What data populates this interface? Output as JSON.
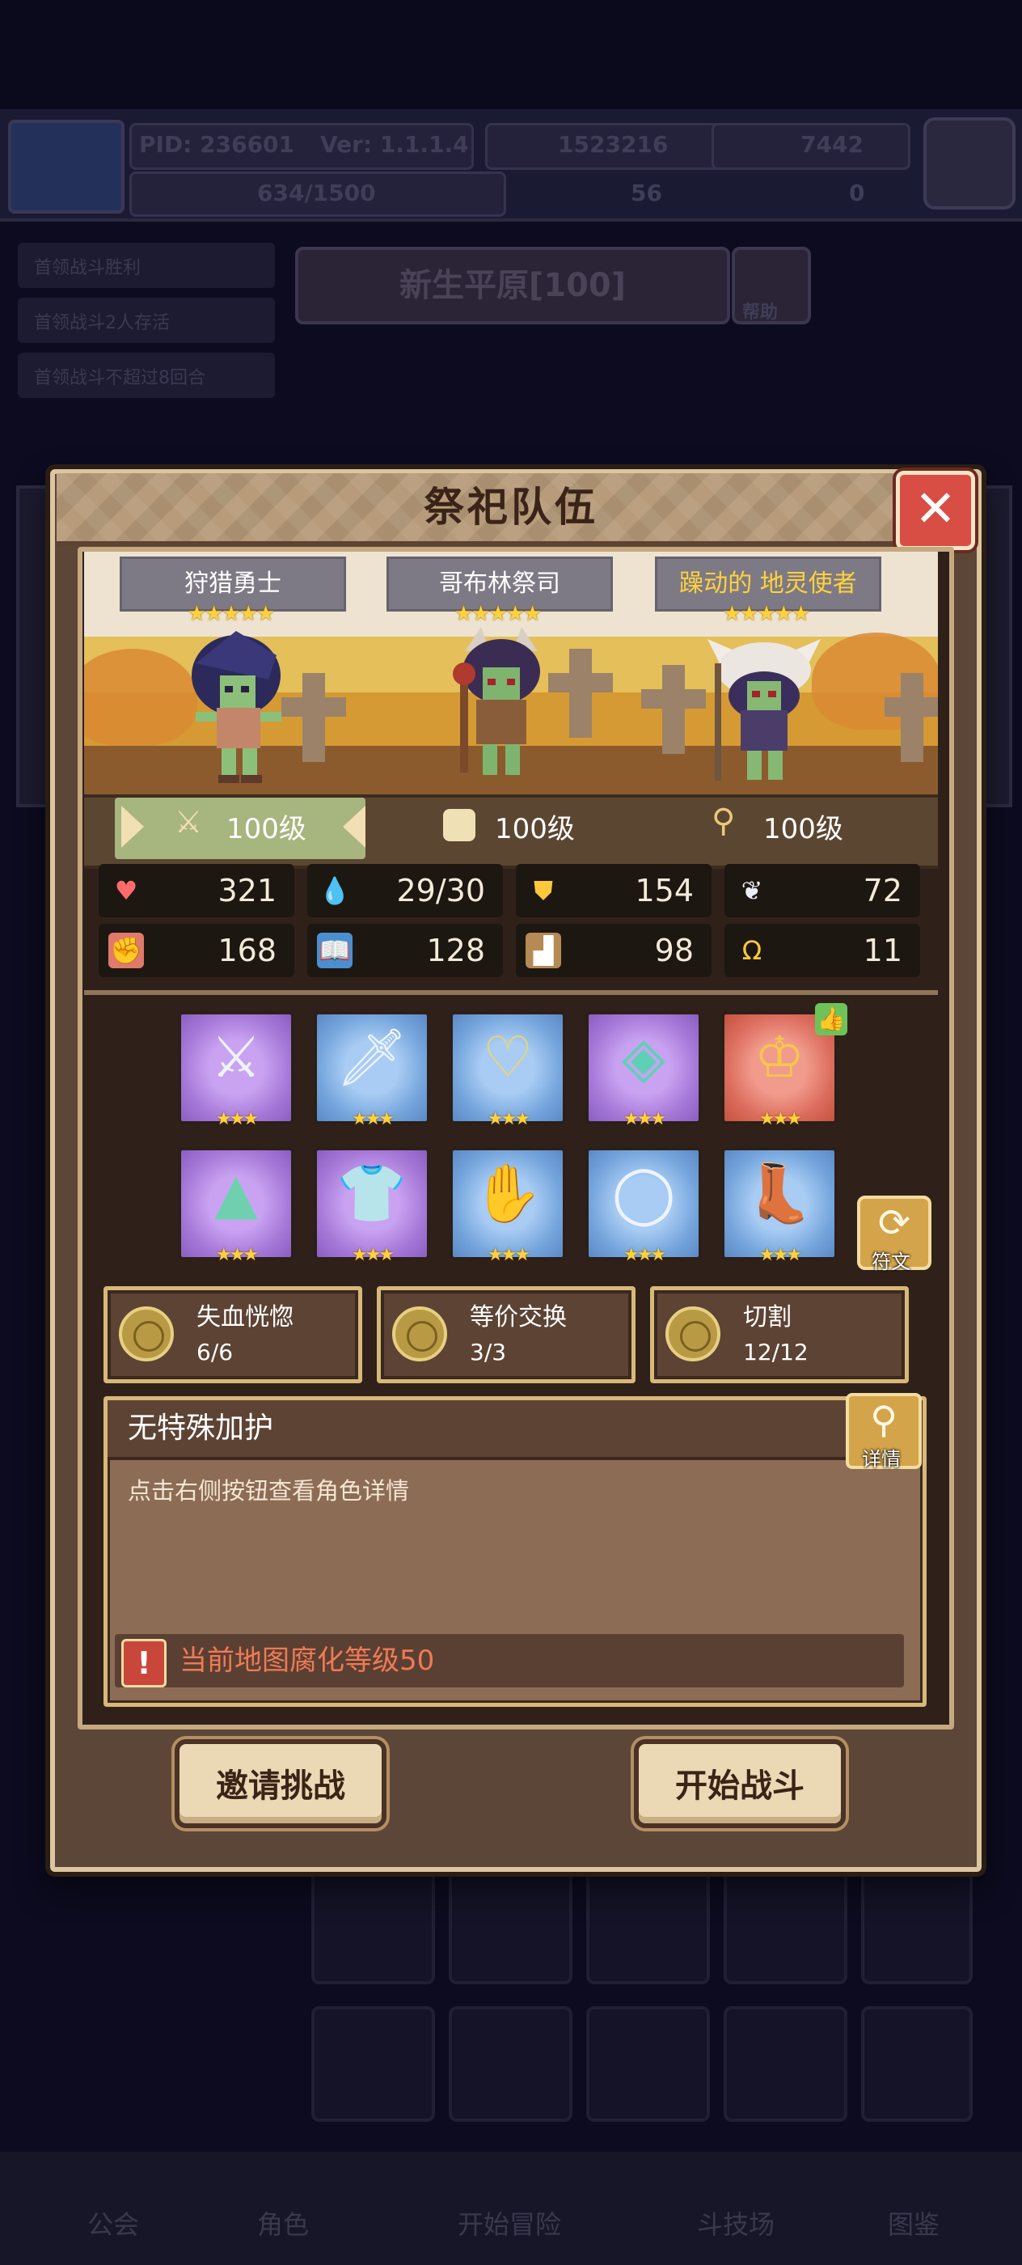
{
  "background": {
    "pid": "PID: 236601",
    "version": "Ver: 1.1.1.4",
    "gold": "1523216",
    "gems": "7442",
    "exp": "634/1500",
    "res3": "56",
    "res4": "0",
    "quests": [
      "首领战斗胜利",
      "首领战斗2人存活",
      "首领战斗不超过8回合"
    ],
    "map_title": "新生平原[100]",
    "help": "帮助",
    "nav": [
      "公会",
      "角色",
      "开始冒险",
      "斗技场",
      "图鉴"
    ]
  },
  "modal": {
    "title": "祭祀队伍",
    "close_icon": "✕",
    "heroes": [
      {
        "name": "狩猎勇士",
        "stars": "★★★★★",
        "level": "100级"
      },
      {
        "name": "哥布林祭司",
        "stars": "★★★★★",
        "level": "100级"
      },
      {
        "name": "躁动的 地灵使者",
        "stars": "★★★★★",
        "level": "100级"
      }
    ],
    "stats": {
      "hp": "321",
      "mana": "29/30",
      "defense": "154",
      "speed": "72",
      "attack": "168",
      "magic": "128",
      "resist": "98",
      "luck": "11"
    },
    "equip_stars": "★★★",
    "rune_label": "符文",
    "skills": [
      {
        "name": "失血恍惚",
        "count": "6/6"
      },
      {
        "name": "等价交换",
        "count": "3/3"
      },
      {
        "name": "切割",
        "count": "12/12"
      }
    ],
    "blessing": {
      "title": "无特殊加护",
      "detail_label": "详情",
      "hint": "点击右侧按钮查看角色详情",
      "warning": "当前地图腐化等级50"
    },
    "invite_button": "邀请挑战",
    "start_button": "开始战斗"
  },
  "colors": {
    "accent_gold": "#ffd23c",
    "warning": "#f07a55",
    "close": "#d84e44"
  }
}
